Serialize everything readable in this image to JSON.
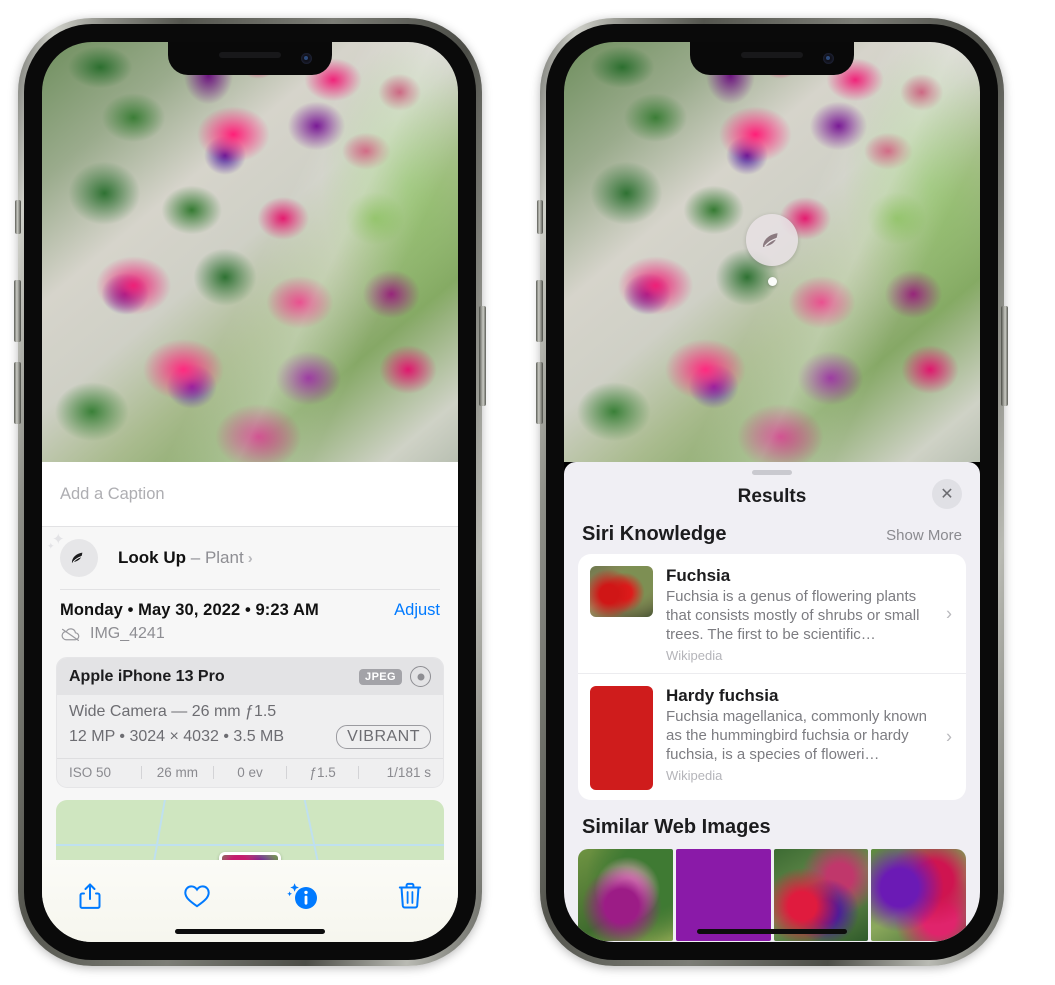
{
  "left_phone": {
    "caption_field": {
      "placeholder": "Add a Caption",
      "value": ""
    },
    "look_up": {
      "label": "Look Up",
      "dash": "–",
      "subject": "Plant",
      "chevron": "›",
      "icon": "leaf-icon"
    },
    "metadata": {
      "date": "Monday • May 30, 2022 • 9:23 AM",
      "adjust_label": "Adjust",
      "filename": "IMG_4241",
      "cloud_icon": "cloud-slash-icon"
    },
    "exif": {
      "device": "Apple iPhone 13 Pro",
      "format_badge": "JPEG",
      "aperture_icon": "aperture-icon",
      "lens_line": "Wide Camera — 26 mm ƒ1.5",
      "spec_line": "12 MP • 3024 × 4032 • 3.5 MB",
      "style_badge": "VIBRANT",
      "shot_values": [
        "ISO 50",
        "26 mm",
        "0 ev",
        "ƒ1.5",
        "1/181 s"
      ]
    },
    "toolbar": [
      {
        "name": "share-button",
        "icon": "share-icon"
      },
      {
        "name": "favorite-button",
        "icon": "heart-icon"
      },
      {
        "name": "info-button",
        "icon": "info-sparkle-icon"
      },
      {
        "name": "delete-button",
        "icon": "trash-icon"
      }
    ]
  },
  "right_phone": {
    "photo_badge": {
      "icon": "leaf-icon"
    },
    "sheet": {
      "title": "Results",
      "close_label": "✕",
      "sections": [
        {
          "title": "Siri Knowledge",
          "action": "Show More",
          "items": [
            {
              "title": "Fuchsia",
              "description": "Fuchsia is a genus of flowering plants that consists mostly of shrubs or small trees. The first to be scientific…",
              "source": "Wikipedia",
              "chevron": "›"
            },
            {
              "title": "Hardy fuchsia",
              "description": "Fuchsia magellanica, commonly known as the hummingbird fuchsia or hardy fuchsia, is a species of floweri…",
              "source": "Wikipedia",
              "chevron": "›"
            }
          ]
        },
        {
          "title": "Similar Web Images",
          "thumbnails": [
            "web-image-1",
            "web-image-2",
            "web-image-3",
            "web-image-4"
          ]
        }
      ]
    }
  },
  "colors": {
    "accent_blue": "#007aff",
    "sheet_bg": "#f0eff4",
    "info_bg": "#f7f7f7",
    "secondary_text": "#8e8e93"
  }
}
